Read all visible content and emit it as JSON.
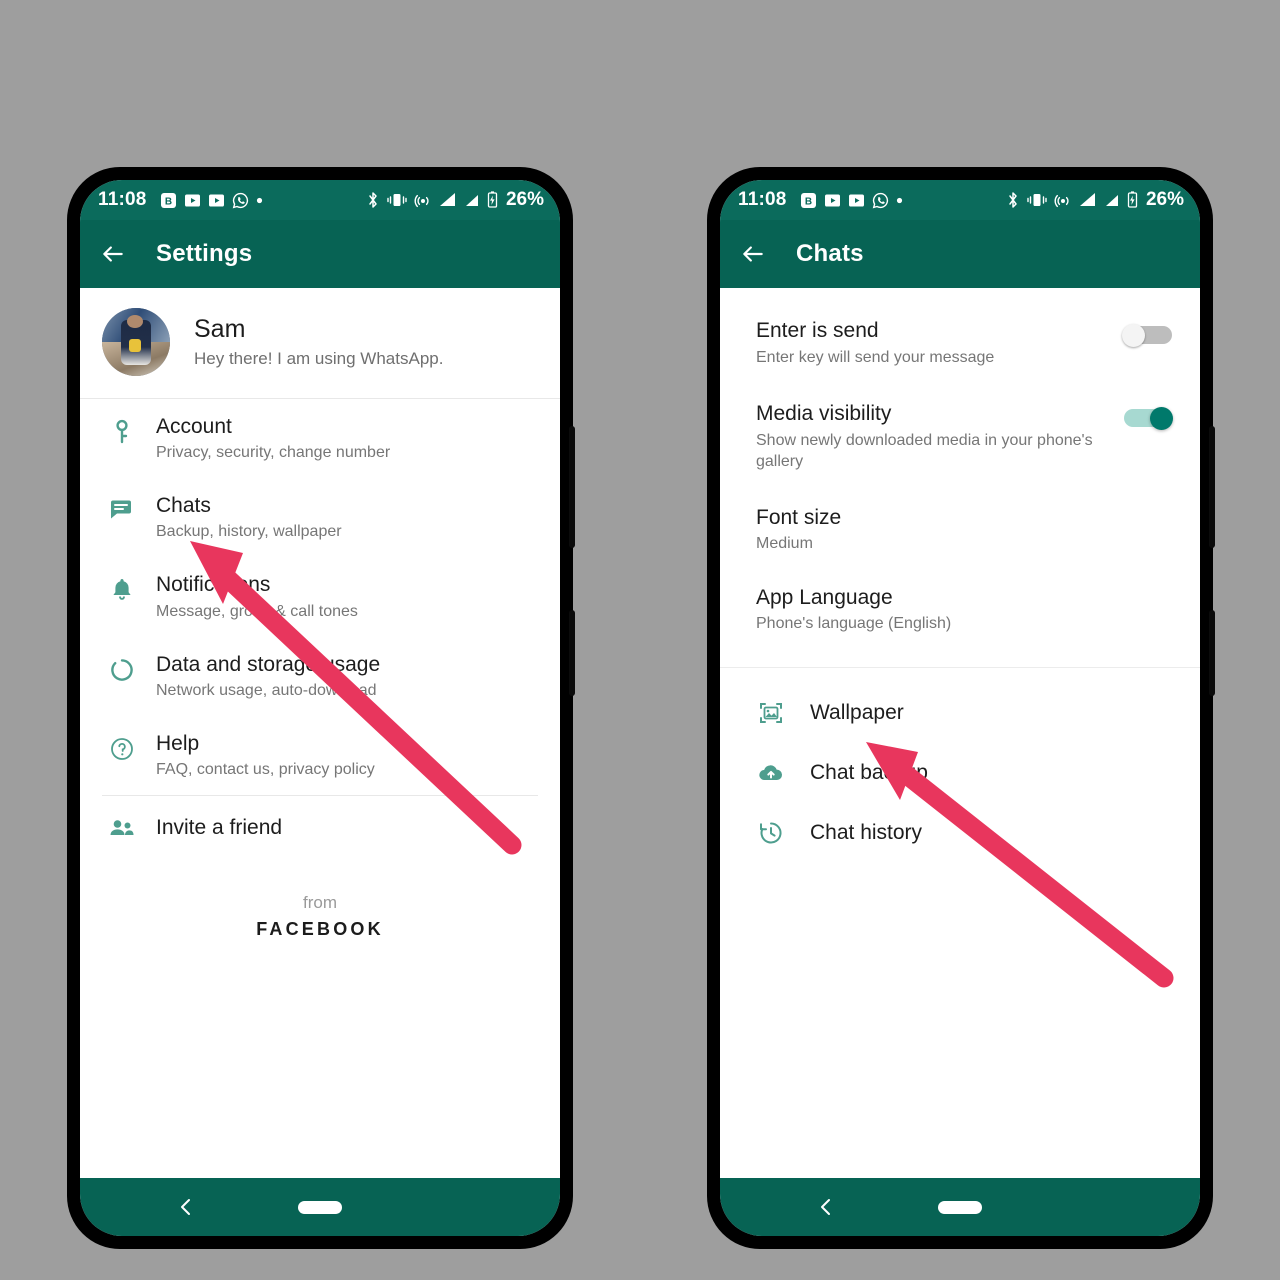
{
  "background_color": "#9e9e9e",
  "accent_colors": {
    "header_teal": "#076354",
    "statusbar_teal": "#0b6b5c",
    "icon_teal": "#4e9e8e",
    "toggle_on": "#00796b",
    "arrow_red": "#e8365d"
  },
  "status_bar": {
    "time": "11:08",
    "battery_percent": "26%",
    "left_icons": [
      "badge-b-icon",
      "video-box-icon",
      "video-box-icon",
      "whatsapp-icon",
      "dot-icon"
    ],
    "right_icons": [
      "bluetooth-icon",
      "vibrate-icon",
      "hotspot-icon",
      "signal-icon",
      "signal-icon",
      "battery-charging-icon"
    ]
  },
  "left_phone": {
    "appbar": {
      "title": "Settings",
      "back_icon": "back-arrow-icon"
    },
    "profile": {
      "name": "Sam",
      "status": "Hey there! I am using WhatsApp.",
      "avatar_icon": "avatar-photo"
    },
    "items": [
      {
        "icon": "key-icon",
        "title": "Account",
        "subtitle": "Privacy, security, change number"
      },
      {
        "icon": "chat-bubble-icon",
        "title": "Chats",
        "subtitle": "Backup, history, wallpaper"
      },
      {
        "icon": "bell-icon",
        "title": "Notifications",
        "subtitle": "Message, group & call tones"
      },
      {
        "icon": "data-usage-icon",
        "title": "Data and storage usage",
        "subtitle": "Network usage, auto-download"
      },
      {
        "icon": "help-icon",
        "title": "Help",
        "subtitle": "FAQ, contact us, privacy policy"
      }
    ],
    "invite": {
      "icon": "people-icon",
      "title": "Invite a friend"
    },
    "footer": {
      "from": "from",
      "brand": "FACEBOOK"
    },
    "navbar": {
      "back_icon": "nav-back-icon",
      "home_pill": "home-pill"
    }
  },
  "right_phone": {
    "appbar": {
      "title": "Chats",
      "back_icon": "back-arrow-icon"
    },
    "toggle_items": [
      {
        "title": "Enter is send",
        "subtitle": "Enter key will send your message",
        "state": "off"
      },
      {
        "title": "Media visibility",
        "subtitle": "Show newly downloaded media in your phone's gallery",
        "state": "on"
      }
    ],
    "value_items": [
      {
        "title": "Font size",
        "value": "Medium"
      },
      {
        "title": "App Language",
        "value": "Phone's language (English)"
      }
    ],
    "link_items": [
      {
        "icon": "wallpaper-icon",
        "title": "Wallpaper"
      },
      {
        "icon": "cloud-upload-icon",
        "title": "Chat backup"
      },
      {
        "icon": "history-icon",
        "title": "Chat history"
      }
    ],
    "navbar": {
      "back_icon": "nav-back-icon",
      "home_pill": "home-pill"
    }
  },
  "annotations": [
    {
      "name": "arrow-to-chats",
      "target": "Chats"
    },
    {
      "name": "arrow-to-chat-backup",
      "target": "Chat backup"
    }
  ]
}
